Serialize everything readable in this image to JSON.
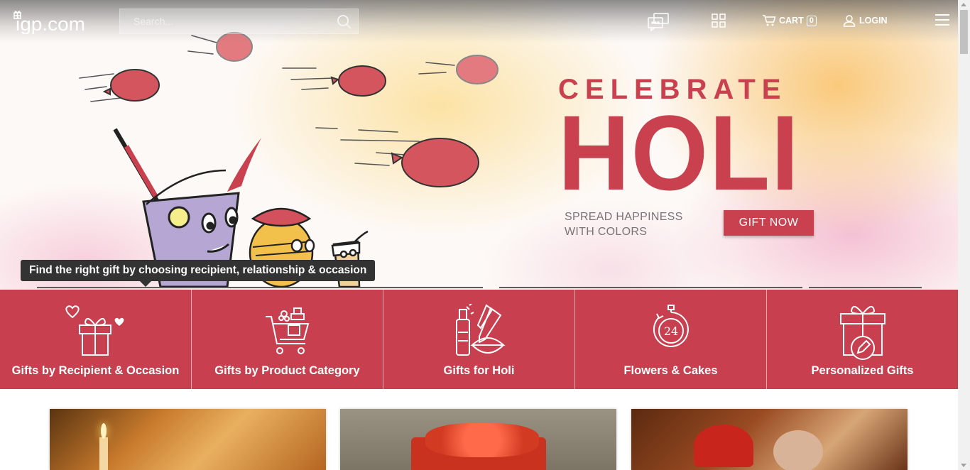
{
  "header": {
    "logo_text": "igp.com",
    "search_placeholder": "Search...",
    "cart_label": "CART",
    "cart_count": "0",
    "login_label": "LOGIN"
  },
  "hero": {
    "headline_small": "CELEBRATE",
    "headline_large": "HOLI",
    "tagline_line1": "SPREAD HAPPINESS",
    "tagline_line2": "WITH COLORS",
    "cta_label": "GIFT NOW"
  },
  "tooltip": {
    "text": "Find the right gift by choosing recipient, relationship & occasion"
  },
  "categories": [
    {
      "label": "Gifts by Recipient & Occasion",
      "icon": "gift-box-hearts-icon"
    },
    {
      "label": "Gifts by Product Category",
      "icon": "shopping-cart-icon"
    },
    {
      "label": "Gifts for Holi",
      "icon": "holi-colors-icon"
    },
    {
      "label": "Flowers & Cakes",
      "icon": "24-hour-delivery-icon"
    },
    {
      "label": "Personalized Gifts",
      "icon": "personalized-gift-icon"
    }
  ],
  "colors": {
    "brand": "#c8404f",
    "text_muted": "#7a7377",
    "tooltip_bg": "#333333"
  }
}
